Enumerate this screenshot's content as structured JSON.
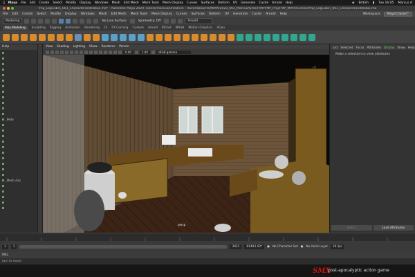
{
  "mac_menu": {
    "app": "Maya",
    "items": [
      "File",
      "Edit",
      "Create",
      "Select",
      "Modify",
      "Display",
      "Windows",
      "Mesh",
      "Edit Mesh",
      "Mesh Tools",
      "Mesh Display",
      "Curves",
      "Surfaces",
      "Deform",
      "UV",
      "Generate",
      "Cache",
      "Arnold",
      "Help"
    ],
    "status": {
      "input": "British",
      "clock": "Tue 16:05",
      "user": "Marcus A"
    }
  },
  "window_title": "fmp_LogCabin_003_Characterandstatus.ma* - Autodesk Maya 2020: /Users/marcus/OneDrive - Ravensbourne/MAYA/2020_003_MarcusAyres/FMP/FMP_Proj/FMP_MAYA/scenes/fmp_LogCabin_003_Characterandstatus.ma",
  "maya_menu": {
    "items": [
      "File",
      "Edit",
      "Create",
      "Select",
      "Modify",
      "Display",
      "Windows",
      "Mesh",
      "Edit Mesh",
      "Mesh Tools",
      "Mesh Display",
      "Curves",
      "Surfaces",
      "Deform",
      "UV",
      "Generate",
      "Cache",
      "Arnold",
      "Help"
    ],
    "workspace_label": "Workspace:",
    "workspace_value": "Maya Classic*"
  },
  "status_line": {
    "mode": "Modeling",
    "live_surface": "No Live Surface",
    "symmetry": "Symmetry: Off",
    "renderer": "Arnold"
  },
  "shelf_tabs": [
    "Poly Modeling",
    "Sculpting",
    "Rigging",
    "Animation",
    "Rendering",
    "FX",
    "FX Caching",
    "Custom",
    "Arnold",
    "Bifrost",
    "MASH",
    "Motion Graphics",
    "XGen"
  ],
  "shelf_active": "Poly Modeling",
  "outliner": {
    "header": "Help",
    "items": [
      "",
      "",
      "",
      "",
      "",
      "",
      "",
      "",
      "",
      "",
      "",
      "",
      "_Pedo",
      "",
      "",
      "",
      "",
      "",
      "",
      "",
      "",
      "",
      "",
      "_Mesh_Grp",
      "",
      "",
      "",
      "",
      ""
    ]
  },
  "viewport": {
    "menu": [
      "View",
      "Shading",
      "Lighting",
      "Show",
      "Renderer",
      "Panels"
    ],
    "near": "0.00",
    "far": "1.00",
    "color_space": "sRGB gamma",
    "camera": "persp"
  },
  "attribute_editor": {
    "tabs": [
      "List",
      "Selected",
      "Focus",
      "Attributes",
      "Display",
      "Show",
      "Help"
    ],
    "active_tab": "Display",
    "message": "Make a selection to view attributes",
    "select_label": "Select",
    "load_label": "Load Attributes"
  },
  "time_range": {
    "start": "1",
    "end": "120",
    "current": "3421",
    "end_max": "81493.43*",
    "character_set": "No Character Set",
    "anim_layer": "No Anim Layer",
    "fps": "24 fps"
  },
  "command_line": "MEL",
  "help_line": "turn to move",
  "footer": {
    "logo": "SMX",
    "tagline": "post-apocalyptic action game"
  },
  "colors": {
    "maya_accent": "#6fd36f",
    "logo_red": "#c11"
  }
}
